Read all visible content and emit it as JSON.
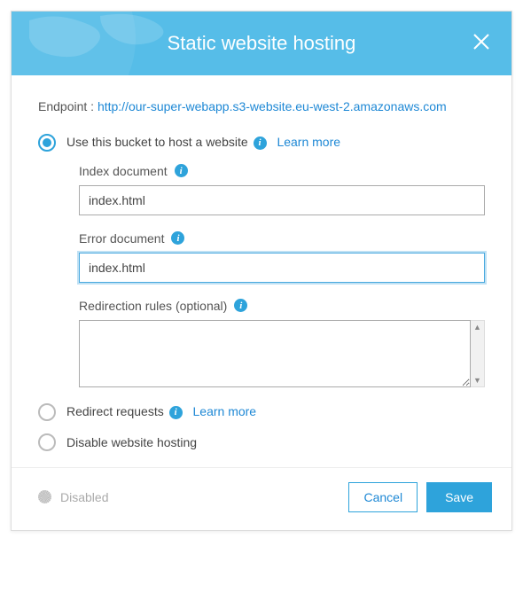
{
  "header": {
    "title": "Static website hosting"
  },
  "endpoint": {
    "label_prefix": "Endpoint : ",
    "url": "http://our-super-webapp.s3-website.eu-west-2.amazonaws.com"
  },
  "options": {
    "host": {
      "label": "Use this bucket to host a website",
      "learn_more": "Learn more",
      "selected": true,
      "fields": {
        "index_label": "Index document",
        "index_value": "index.html",
        "error_label": "Error document",
        "error_value": "index.html",
        "redirect_rules_label": "Redirection rules (optional)",
        "redirect_rules_value": ""
      }
    },
    "redirect": {
      "label": "Redirect requests",
      "learn_more": "Learn more"
    },
    "disable": {
      "label": "Disable website hosting"
    }
  },
  "footer": {
    "status_text": "Disabled",
    "cancel_label": "Cancel",
    "save_label": "Save"
  },
  "colors": {
    "accent": "#2ea3db",
    "header_bg": "#56bde8",
    "link": "#1e88d5"
  }
}
